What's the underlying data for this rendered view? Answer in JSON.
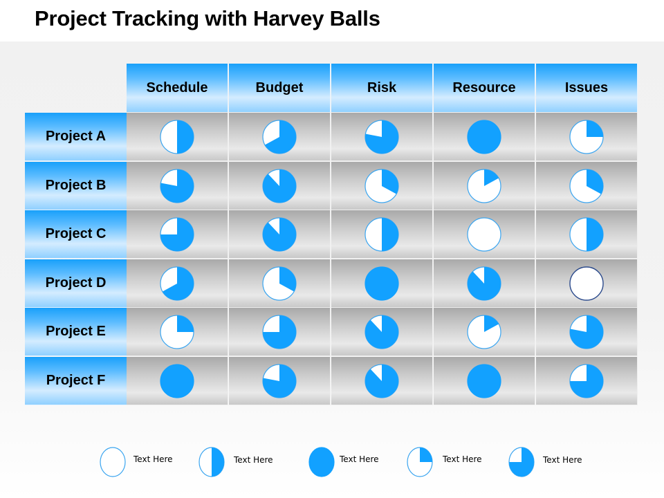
{
  "title": "Project Tracking with Harvey Balls",
  "colors": {
    "fill": "#12a1ff",
    "outline": "#3aa5f0",
    "empty_outline_dark": "#2b4a8c"
  },
  "table": {
    "columns": [
      "Schedule",
      "Budget",
      "Risk",
      "Resource",
      "Issues"
    ],
    "rows": [
      {
        "label": "Project A",
        "values": [
          0.5,
          0.67,
          0.78,
          1.0,
          0.25
        ]
      },
      {
        "label": "Project B",
        "values": [
          0.78,
          0.88,
          0.33,
          0.17,
          0.33
        ]
      },
      {
        "label": "Project C",
        "values": [
          0.75,
          0.88,
          0.5,
          0.0,
          0.5
        ]
      },
      {
        "label": "Project D",
        "values": [
          0.67,
          0.33,
          1.0,
          0.88,
          0.0
        ]
      },
      {
        "label": "Project E",
        "values": [
          0.25,
          0.75,
          0.88,
          0.17,
          0.78
        ]
      },
      {
        "label": "Project F",
        "values": [
          1.0,
          0.78,
          0.88,
          1.0,
          0.75
        ]
      }
    ]
  },
  "legend": [
    {
      "text": "Text Here",
      "value": 0.0
    },
    {
      "text": "Text Here",
      "value": 0.5
    },
    {
      "text": "Text Here",
      "value": 1.0
    },
    {
      "text": "Text Here",
      "value": 0.25
    },
    {
      "text": "Text Here",
      "value": 0.75
    }
  ]
}
